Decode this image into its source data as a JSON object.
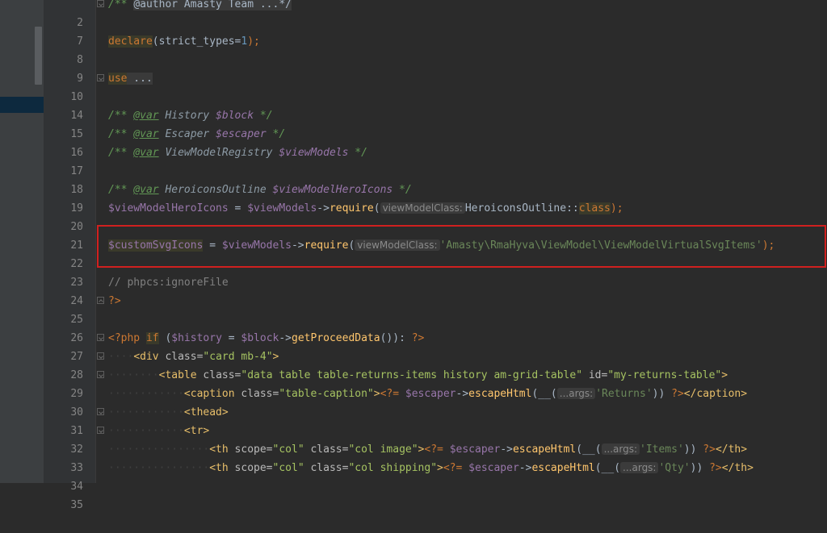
{
  "line_numbers": [
    "2",
    "7",
    "8",
    "9",
    "10",
    "14",
    "15",
    "16",
    "17",
    "18",
    "19",
    "20",
    "21",
    "22",
    "23",
    "24",
    "25",
    "26",
    "27",
    "28",
    "29",
    "30",
    "31",
    "32",
    "33",
    "34",
    "35"
  ],
  "code": {
    "l2": {
      "open": "/** ",
      "author_tag": "@author Amasty Team ...*/"
    },
    "l8": {
      "declare": "declare",
      "paren_open": "(",
      "name": "strict_types",
      "eq": "=",
      "num": "1",
      "close": ");"
    },
    "l10": {
      "kw": "use",
      "rest": " ..."
    },
    "l15": {
      "open": "/** ",
      "tag": "@var",
      "type": " History ",
      "var": "$block",
      "close": " */"
    },
    "l16": {
      "open": "/** ",
      "tag": "@var",
      "type": " Escaper ",
      "var": "$escaper",
      "close": " */"
    },
    "l17": {
      "open": "/** ",
      "tag": "@var",
      "type": " ViewModelRegistry ",
      "var": "$viewModels",
      "close": " */"
    },
    "l19": {
      "open": "/** ",
      "tag": "@var",
      "type": " HeroiconsOutline ",
      "var": "$viewModelHeroIcons",
      "close": " */"
    },
    "l20": {
      "var1": "$viewModelHeroIcons",
      "eq": " = ",
      "var2": "$viewModels",
      "arrow": "->",
      "fn": "require",
      "paren": "(",
      "hint": "viewModelClass:",
      "cls": "HeroiconsOutline::",
      "kw": "class",
      "close": ");"
    },
    "l22": {
      "var1": "$customSvgIcons",
      "eq": " = ",
      "var2": "$viewModels",
      "arrow": "->",
      "fn": "require",
      "paren": "(",
      "hint": "viewModelClass:",
      "str": "'Amasty\\RmaHyva\\ViewModel\\ViewModelVirtualSvgItems'",
      "close": ");"
    },
    "l24": {
      "comment": "// phpcs:ignoreFile"
    },
    "l25": {
      "close_tag": "?>"
    },
    "l27": {
      "open": "<?php ",
      "kw": "if",
      "p1": " (",
      "var1": "$history",
      "eq": " = ",
      "var2": "$block",
      "arrow": "->",
      "fn": "getProceedData",
      "p2": "()): ",
      "close": "?>"
    },
    "l28": {
      "dots": "····",
      "open": "<div ",
      "attr": "class=",
      "val": "\"card mb-4\"",
      "close": ">"
    },
    "l29": {
      "dots": "········",
      "open": "<table ",
      "attr": "class=",
      "val": "\"data table table-returns-items history am-grid-table\"",
      "attr2": " id=",
      "val2": "\"my-returns-table\"",
      "close": ">"
    },
    "l30": {
      "dots": "············",
      "open": "<caption ",
      "attr": "class=",
      "val": "\"table-caption\"",
      "close": ">",
      "php": "<?= ",
      "var": "$escaper",
      "arrow": "->",
      "fn": "escapeHtml",
      "p1": "(__(",
      "hint": "...args:",
      "str": "'Returns'",
      "p2": ")) ",
      "phpclose": "?>",
      "endtag": "</caption>"
    },
    "l31": {
      "dots": "············",
      "tag": "<thead>"
    },
    "l32": {
      "dots": "············",
      "tag": "<tr>"
    },
    "l33": {
      "dots": "················",
      "open": "<th ",
      "attr": "scope=",
      "val": "\"col\"",
      "attr2": " class=",
      "val2": "\"col image\"",
      "close": ">",
      "php": "<?= ",
      "var": "$escaper",
      "arrow": "->",
      "fn": "escapeHtml",
      "p1": "(__(",
      "hint": "...args:",
      "str": "'Items'",
      "p2": ")) ",
      "phpclose": "?>",
      "endtag": "</th>"
    },
    "l34": {
      "dots": "················",
      "open": "<th ",
      "attr": "scope=",
      "val": "\"col\"",
      "attr2": " class=",
      "val2": "\"col shipping\"",
      "close": ">",
      "php": "<?= ",
      "var": "$escaper",
      "arrow": "->",
      "fn": "escapeHtml",
      "p1": "(__(",
      "hint": "...args:",
      "str": "'Qty'",
      "p2": ")) ",
      "phpclose": "?>",
      "endtag": "</th>"
    }
  }
}
